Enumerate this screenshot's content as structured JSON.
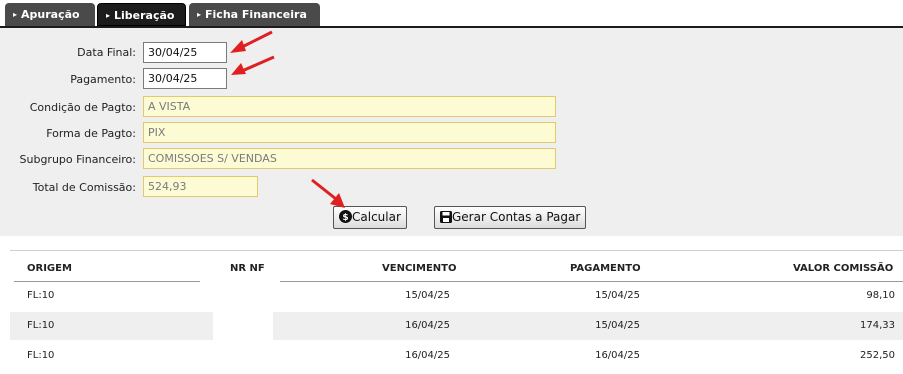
{
  "tabs": [
    {
      "label": "Apuração",
      "active": false
    },
    {
      "label": "Liberação",
      "active": true
    },
    {
      "label": "Ficha Financeira",
      "active": false
    }
  ],
  "form": {
    "data_final": {
      "label": "Data Final:",
      "value": "30/04/25"
    },
    "pagamento": {
      "label": "Pagamento:",
      "value": "30/04/25"
    },
    "condicao": {
      "label": "Condição de Pagto:",
      "value": "A VISTA"
    },
    "forma": {
      "label": "Forma de Pagto:",
      "value": "PIX"
    },
    "subgrupo": {
      "label": "Subgrupo Financeiro:",
      "value": "COMISSOES S/ VENDAS"
    },
    "total": {
      "label": "Total de Comissão:",
      "value": "524,93"
    }
  },
  "buttons": {
    "calcular": "Calcular",
    "gerar": "Gerar Contas a Pagar"
  },
  "table": {
    "headers": [
      "ORIGEM",
      "NR NF",
      "VENCIMENTO",
      "PAGAMENTO",
      "VALOR COMISSÃO"
    ],
    "rows": [
      {
        "origem": "FL:10",
        "nr_nf": "",
        "vencimento": "15/04/25",
        "pagamento": "15/04/25",
        "valor": "98,10"
      },
      {
        "origem": "FL:10",
        "nr_nf": "",
        "vencimento": "16/04/25",
        "pagamento": "15/04/25",
        "valor": "174,33"
      },
      {
        "origem": "FL:10",
        "nr_nf": "",
        "vencimento": "16/04/25",
        "pagamento": "16/04/25",
        "valor": "252,50"
      }
    ]
  },
  "colors": {
    "tab_bg": "#4a4a4a",
    "tab_active_bg": "#1c1c1c",
    "form_bg": "#efefef",
    "readonly_bg": "#fdfbd4",
    "readonly_border": "#e2c96a",
    "arrow_red": "#e02020"
  }
}
